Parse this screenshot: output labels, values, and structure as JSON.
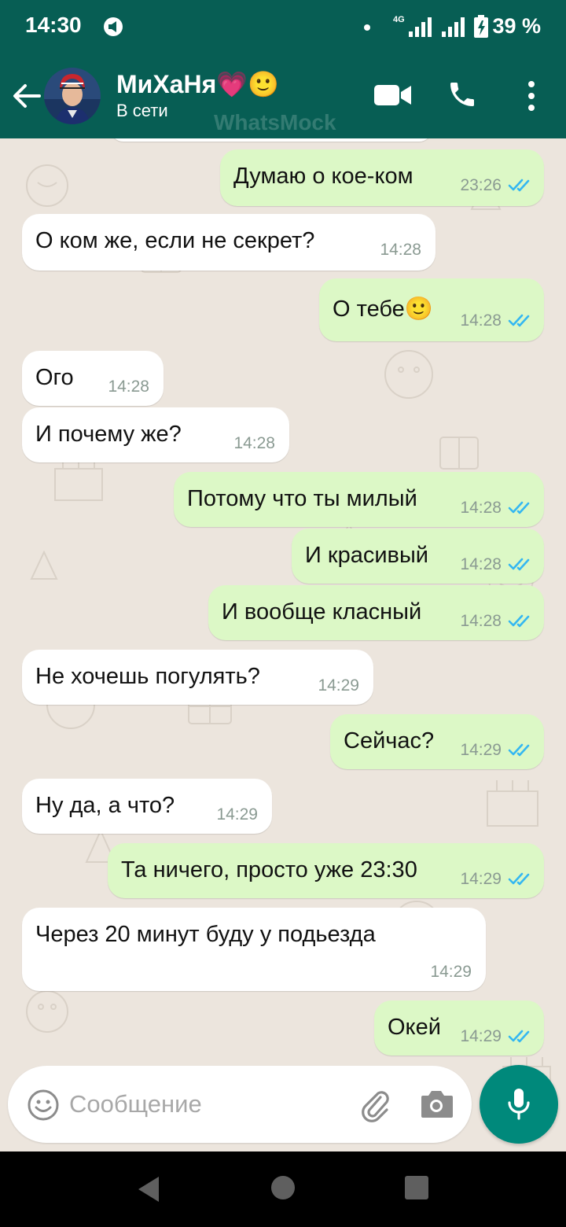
{
  "status_bar": {
    "time": "14:30",
    "network": "4G",
    "battery": "39 %"
  },
  "header": {
    "name": "МиХаНя💗🙂",
    "status": "В сети",
    "watermark": "WhatsMock"
  },
  "messages": [
    {
      "dir": "out",
      "text": "Думаю о кое-ком",
      "time": "23:26",
      "read": true
    },
    {
      "dir": "in",
      "text": "О ком же, если не секрет?",
      "time": "14:28"
    },
    {
      "dir": "out",
      "text": "О тебе🙂",
      "time": "14:28",
      "read": true
    },
    {
      "dir": "in",
      "text": "Ого",
      "time": "14:28"
    },
    {
      "dir": "in",
      "text": "И почему же?",
      "time": "14:28"
    },
    {
      "dir": "out",
      "text": "Потому что ты милый",
      "time": "14:28",
      "read": true
    },
    {
      "dir": "out",
      "text": "И красивый",
      "time": "14:28",
      "read": true
    },
    {
      "dir": "out",
      "text": "И вообще класный",
      "time": "14:28",
      "read": true
    },
    {
      "dir": "in",
      "text": "Не хочешь погулять?",
      "time": "14:29"
    },
    {
      "dir": "out",
      "text": "Сейчас?",
      "time": "14:29",
      "read": true
    },
    {
      "dir": "in",
      "text": "Ну да, а что?",
      "time": "14:29"
    },
    {
      "dir": "out",
      "text": "Та ничего, просто уже 23:30",
      "time": "14:29",
      "read": true
    },
    {
      "dir": "in",
      "text": "Через 20 минут буду у подьезда",
      "time": "14:29"
    },
    {
      "dir": "out",
      "text": "Окей",
      "time": "14:29",
      "read": true
    }
  ],
  "composer": {
    "placeholder": "Сообщение"
  },
  "colors": {
    "header": "#075e54",
    "chat_background": "#ece5dd",
    "outgoing_bubble": "#dcf8c6",
    "incoming_bubble": "#ffffff",
    "read_ticks": "#34b7f1",
    "mic_button": "#00897b"
  },
  "icons": [
    "back-arrow-icon",
    "video-call-icon",
    "voice-call-icon",
    "more-options-icon",
    "emoji-icon",
    "attach-icon",
    "camera-icon",
    "mic-icon"
  ]
}
